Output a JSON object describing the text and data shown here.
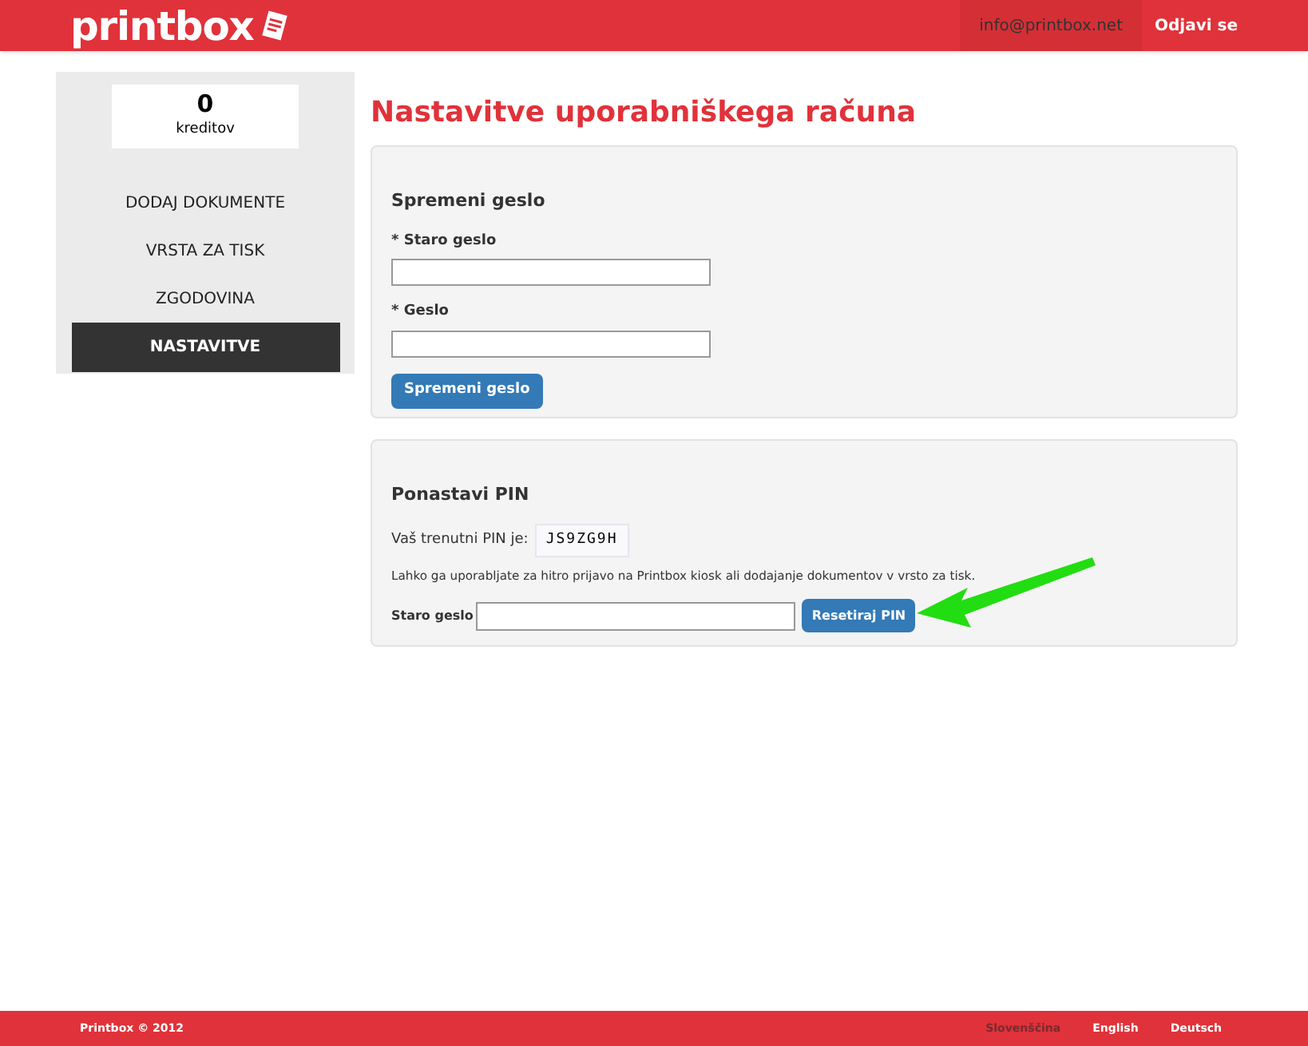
{
  "header": {
    "logo": "printbox",
    "email": "info@printbox.net",
    "logout": "Odjavi se"
  },
  "sidebar": {
    "credits": {
      "value": "0",
      "label": "kreditov"
    },
    "items": [
      {
        "label": "DODAJ DOKUMENTE",
        "selected": false
      },
      {
        "label": "VRSTA ZA TISK",
        "selected": false
      },
      {
        "label": "ZGODOVINA",
        "selected": false
      },
      {
        "label": "NASTAVITVE",
        "selected": true
      }
    ]
  },
  "page_title": "Nastavitve uporabniškega računa",
  "password_panel": {
    "title": "Spremeni geslo",
    "fields": [
      {
        "label": "* Staro geslo"
      },
      {
        "label": "* Geslo"
      }
    ],
    "button": "Spremeni geslo"
  },
  "pin_panel": {
    "title": "Ponastavi PIN",
    "pin_label": "Vaš trenutni PIN je:",
    "pin": "JS9ZG9H",
    "description": "Lahko ga uporabljate za hitro prijavo na Printbox kiosk ali dodajanje dokumentov v vrsto za tisk.",
    "field_label": "Staro geslo",
    "button": "Resetiraj PIN"
  },
  "footer": {
    "copyright": "Printbox © 2012",
    "languages": [
      {
        "label": "Slovenščina",
        "selected": true
      },
      {
        "label": "English",
        "selected": false
      },
      {
        "label": "Deutsch",
        "selected": false
      }
    ]
  }
}
